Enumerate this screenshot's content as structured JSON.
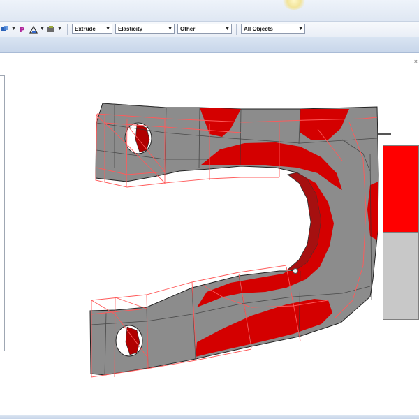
{
  "toolbar": {
    "combos": [
      "Extrude",
      "Elasticity",
      "Other",
      "All Objects"
    ],
    "icons": [
      "select-icon",
      "component-icon",
      "measure-icon",
      "view-icon"
    ]
  },
  "viewport": {
    "object": "fork-shaped part with two bolt holes",
    "colors": {
      "high_region": "#d40000",
      "low_region": "#8c8c8c",
      "wireframe": "#ff5a5a"
    }
  },
  "legend": {
    "colors": [
      "#ff0000",
      "#c8c8c8"
    ]
  },
  "colors": {
    "titlebar": "#e6edf7",
    "toolbar": "#eef2f8",
    "band": "#cfdcee"
  }
}
